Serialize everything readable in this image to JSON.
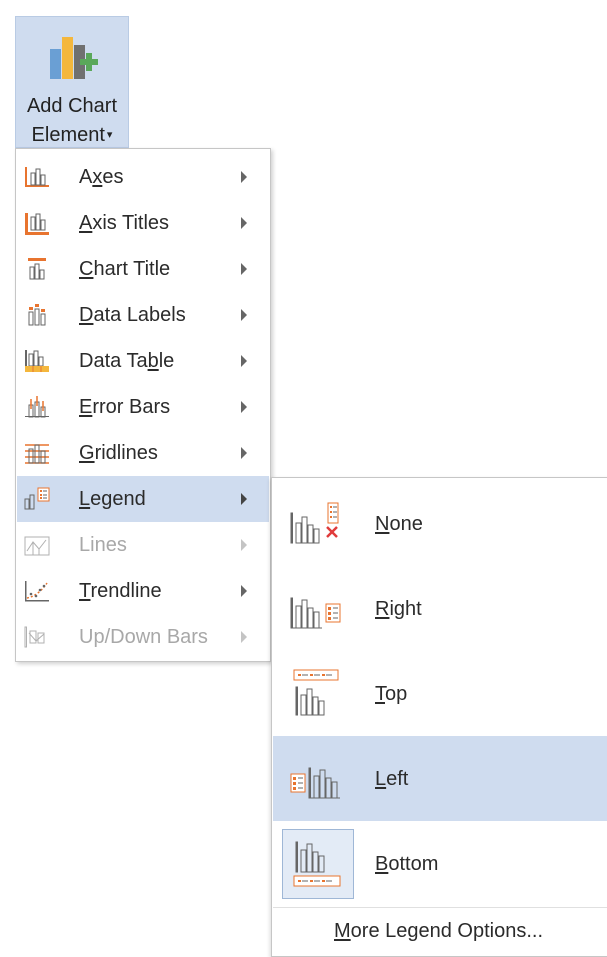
{
  "ribbon": {
    "button_line1": "Add Chart",
    "button_line2": "Element",
    "icon": "add-chart-element-icon"
  },
  "menu": {
    "items": [
      {
        "pre": "A",
        "ul": "x",
        "post": "es",
        "icon": "axes-icon",
        "enabled": true
      },
      {
        "pre": "",
        "ul": "A",
        "post": "xis Titles",
        "icon": "axis-titles-icon",
        "enabled": true
      },
      {
        "pre": "",
        "ul": "C",
        "post": "hart Title",
        "icon": "chart-title-icon",
        "enabled": true
      },
      {
        "pre": "",
        "ul": "D",
        "post": "ata Labels",
        "icon": "data-labels-icon",
        "enabled": true
      },
      {
        "pre": "Data Ta",
        "ul": "b",
        "post": "le",
        "icon": "data-table-icon",
        "enabled": true
      },
      {
        "pre": "",
        "ul": "E",
        "post": "rror Bars",
        "icon": "error-bars-icon",
        "enabled": true
      },
      {
        "pre": "",
        "ul": "G",
        "post": "ridlines",
        "icon": "gridlines-icon",
        "enabled": true
      },
      {
        "pre": "",
        "ul": "L",
        "post": "egend",
        "icon": "legend-icon",
        "enabled": true,
        "highlighted": true
      },
      {
        "pre": "",
        "ul": "",
        "post": "Lines",
        "icon": "lines-icon",
        "enabled": false
      },
      {
        "pre": "",
        "ul": "T",
        "post": "rendline",
        "icon": "trendline-icon",
        "enabled": true
      },
      {
        "pre": "",
        "ul": "",
        "post": "Up/Down Bars",
        "icon": "up-down-bars-icon",
        "enabled": false
      }
    ]
  },
  "legend_submenu": {
    "items": [
      {
        "ul": "N",
        "post": "one",
        "icon": "legend-none-icon"
      },
      {
        "ul": "R",
        "post": "ight",
        "icon": "legend-right-icon"
      },
      {
        "ul": "T",
        "post": "op",
        "icon": "legend-top-icon"
      },
      {
        "ul": "L",
        "post": "eft",
        "icon": "legend-left-icon",
        "highlighted": true
      },
      {
        "ul": "B",
        "post": "ottom",
        "icon": "legend-bottom-icon",
        "selected": true
      }
    ],
    "more": {
      "ul": "M",
      "post": "ore Legend Options..."
    }
  },
  "colors": {
    "highlight": "#cfdcef",
    "accent_orange": "#e8742f",
    "accent_yellow": "#f4b73d",
    "accent_green": "#5aa85a",
    "icon_gray": "#6d6d6d",
    "disabled": "#a8a8a8"
  }
}
